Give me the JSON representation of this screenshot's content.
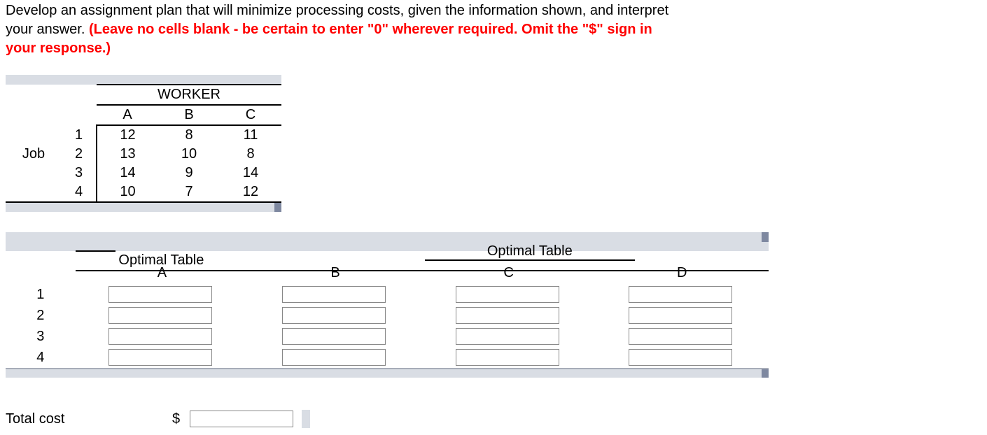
{
  "question": {
    "line1": "Develop an assignment plan that will minimize processing costs, given the information shown, and interpret",
    "line2_pre": "your answer. ",
    "line2_red": "(Leave no cells blank - be certain to enter \"0\" wherever required. Omit the \"$\" sign in",
    "line3_red": "your response.)"
  },
  "cost_table": {
    "title": "WORKER",
    "row_label": "Job",
    "col_headers": [
      "A",
      "B",
      "C"
    ],
    "rows": [
      {
        "n": "1",
        "vals": [
          "12",
          "8",
          "11"
        ]
      },
      {
        "n": "2",
        "vals": [
          "13",
          "10",
          "8"
        ]
      },
      {
        "n": "3",
        "vals": [
          "14",
          "9",
          "14"
        ]
      },
      {
        "n": "4",
        "vals": [
          "10",
          "7",
          "12"
        ]
      }
    ]
  },
  "optimal": {
    "title": "Optimal Table",
    "col_headers": [
      "A",
      "B",
      "C",
      "D"
    ],
    "row_labels": [
      "1",
      "2",
      "3",
      "4"
    ]
  },
  "total": {
    "label": "Total cost",
    "symbol": "$"
  },
  "chart_data": {
    "type": "table",
    "title": "WORKER cost matrix",
    "columns": [
      "Job",
      "A",
      "B",
      "C"
    ],
    "rows": [
      [
        "1",
        12,
        8,
        11
      ],
      [
        "2",
        13,
        10,
        8
      ],
      [
        "3",
        14,
        9,
        14
      ],
      [
        "4",
        10,
        7,
        12
      ]
    ]
  }
}
